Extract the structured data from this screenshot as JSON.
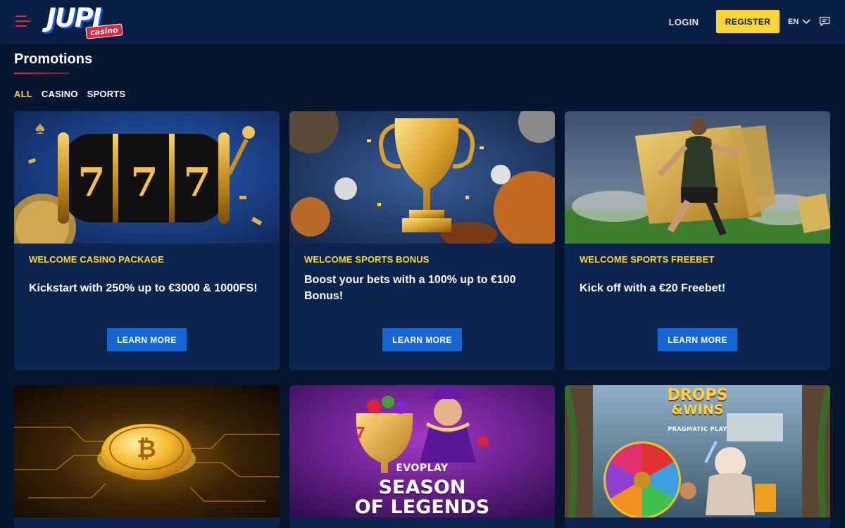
{
  "header": {
    "logo_text": "JUPI",
    "logo_badge": "casino",
    "login_label": "LOGIN",
    "register_label": "REGISTER",
    "language": "EN"
  },
  "page": {
    "title": "Promotions",
    "filters": [
      {
        "label": "ALL",
        "active": true
      },
      {
        "label": "CASINO",
        "active": false
      },
      {
        "label": "SPORTS",
        "active": false
      }
    ]
  },
  "promotions": [
    {
      "category": "WELCOME CASINO PACKAGE",
      "description": "Kickstart with 250% up to €3000 & 1000FS!",
      "button": "LEARN MORE",
      "image_text": "777"
    },
    {
      "category": "WELCOME SPORTS BONUS",
      "description": "Boost your bets with a 100% up to €100 Bonus!",
      "button": "LEARN MORE"
    },
    {
      "category": "WELCOME SPORTS FREEBET",
      "description": "Kick off with a €20 Freebet!",
      "button": "LEARN MORE"
    },
    {
      "image_text": ""
    },
    {
      "image_brand": "EVOPLAY",
      "image_title_1": "SEASON",
      "image_title_2": "OF LEGENDS"
    },
    {
      "image_title_1": "DROPS",
      "image_title_2": "&WINS",
      "image_brand": "PRAGMATIC PLAY"
    }
  ],
  "colors": {
    "background": "#071630",
    "header": "#0a1f44",
    "card": "#0c2550",
    "accent_yellow": "#fcd535",
    "accent_red": "#e0253f",
    "button_blue": "#1568d3"
  }
}
